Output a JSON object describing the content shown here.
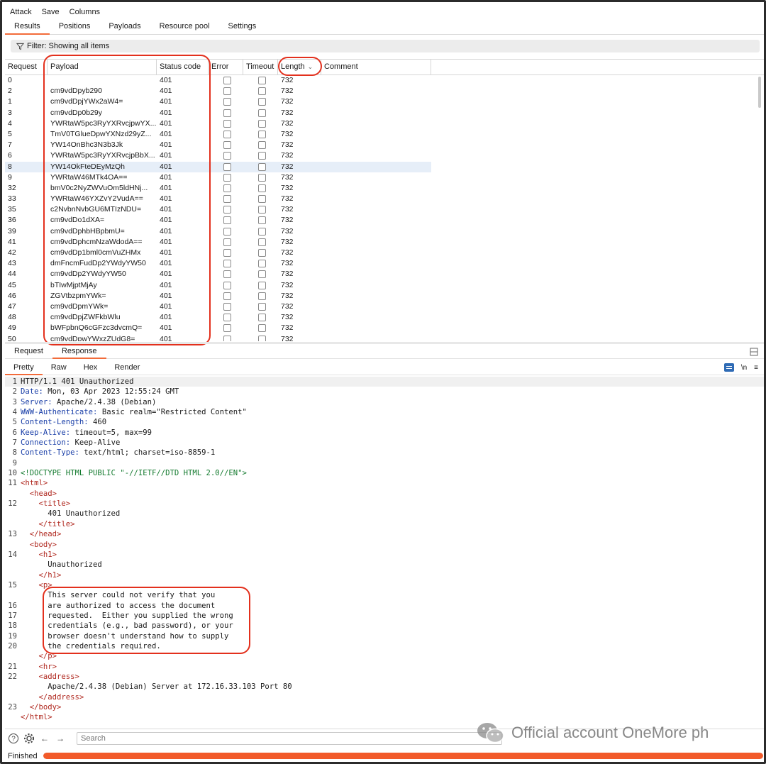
{
  "menu": [
    "Attack",
    "Save",
    "Columns"
  ],
  "attack_tabs": [
    {
      "label": "Results",
      "active": true
    },
    {
      "label": "Positions",
      "active": false
    },
    {
      "label": "Payloads",
      "active": false
    },
    {
      "label": "Resource pool",
      "active": false
    },
    {
      "label": "Settings",
      "active": false
    }
  ],
  "filter": {
    "label": "Filter: Showing all items",
    "icon": "funnel-icon"
  },
  "table": {
    "columns": [
      "Request",
      "Payload",
      "Status code",
      "Error",
      "Timeout",
      "Length",
      "Comment"
    ],
    "sort_column": "Length",
    "selected_request": "8",
    "rows": [
      {
        "request": "0",
        "payload": "",
        "status": "401",
        "length": "732"
      },
      {
        "request": "2",
        "payload": "cm9vdDpyb290",
        "status": "401",
        "length": "732"
      },
      {
        "request": "1",
        "payload": "cm9vdDpjYWx2aW4=",
        "status": "401",
        "length": "732"
      },
      {
        "request": "3",
        "payload": "cm9vdDp0b29y",
        "status": "401",
        "length": "732"
      },
      {
        "request": "4",
        "payload": "YWRtaW5pc3RyYXRvcjpwYX...",
        "status": "401",
        "length": "732"
      },
      {
        "request": "5",
        "payload": "TmV0TGlueDpwYXNzd29yZ...",
        "status": "401",
        "length": "732"
      },
      {
        "request": "7",
        "payload": "YW14OnBhc3N3b3Jk",
        "status": "401",
        "length": "732"
      },
      {
        "request": "6",
        "payload": "YWRtaW5pc3RyYXRvcjpBbX...",
        "status": "401",
        "length": "732"
      },
      {
        "request": "8",
        "payload": "YW14OkFteDEyMzQh",
        "status": "401",
        "length": "732"
      },
      {
        "request": "9",
        "payload": "YWRtaW46MTk4OA==",
        "status": "401",
        "length": "732"
      },
      {
        "request": "32",
        "payload": "bmV0c2NyZWVuOm5ldHNj...",
        "status": "401",
        "length": "732"
      },
      {
        "request": "33",
        "payload": "YWRtaW46YXZvY2VudA==",
        "status": "401",
        "length": "732"
      },
      {
        "request": "35",
        "payload": "c2NvbnNvbGU6MTIzNDU=",
        "status": "401",
        "length": "732"
      },
      {
        "request": "36",
        "payload": "cm9vdDo1dXA=",
        "status": "401",
        "length": "732"
      },
      {
        "request": "39",
        "payload": "cm9vdDphbHBpbmU=",
        "status": "401",
        "length": "732"
      },
      {
        "request": "41",
        "payload": "cm9vdDphcmNzaWdodA==",
        "status": "401",
        "length": "732"
      },
      {
        "request": "42",
        "payload": "cm9vdDp1bml0cmVuZHMx",
        "status": "401",
        "length": "732"
      },
      {
        "request": "43",
        "payload": "dmFncmFudDp2YWdyYW50",
        "status": "401",
        "length": "732"
      },
      {
        "request": "44",
        "payload": "cm9vdDp2YWdyYW50",
        "status": "401",
        "length": "732"
      },
      {
        "request": "45",
        "payload": "bTIwMjptMjAy",
        "status": "401",
        "length": "732"
      },
      {
        "request": "46",
        "payload": "ZGVtbzpmYWk=",
        "status": "401",
        "length": "732"
      },
      {
        "request": "47",
        "payload": "cm9vdDpmYWk=",
        "status": "401",
        "length": "732"
      },
      {
        "request": "48",
        "payload": "cm9vdDpjZWFkbWlu",
        "status": "401",
        "length": "732"
      },
      {
        "request": "49",
        "payload": "bWFpbnQ6cGFzc3dvcmQ=",
        "status": "401",
        "length": "732"
      },
      {
        "request": "50",
        "payload": "cm9vdDpwYWxzZUdG8=",
        "status": "401",
        "length": "732"
      }
    ]
  },
  "message_tabs": [
    {
      "label": "Request",
      "active": false
    },
    {
      "label": "Response",
      "active": true
    }
  ],
  "view_tabs": [
    {
      "label": "Pretty",
      "active": true
    },
    {
      "label": "Raw",
      "active": false
    },
    {
      "label": "Hex",
      "active": false
    },
    {
      "label": "Render",
      "active": false
    }
  ],
  "view_icons": {
    "wrap": "list-icon",
    "newline": "\\n",
    "hidden": "≡"
  },
  "response_lines": [
    {
      "num": "1",
      "text": "HTTP/1.1 401 Unauthorized",
      "kind": "plain"
    },
    {
      "num": "2",
      "key": "Date:",
      "text": " Mon, 03 Apr 2023 12:55:24 GMT",
      "kind": "header"
    },
    {
      "num": "3",
      "key": "Server:",
      "text": " Apache/2.4.38 (Debian)",
      "kind": "header"
    },
    {
      "num": "4",
      "key": "WWW-Authenticate:",
      "text": " Basic realm=\"Restricted Content\"",
      "kind": "header"
    },
    {
      "num": "5",
      "key": "Content-Length:",
      "text": " 460",
      "kind": "header"
    },
    {
      "num": "6",
      "key": "Keep-Alive:",
      "text": " timeout=5, max=99",
      "kind": "header"
    },
    {
      "num": "7",
      "key": "Connection:",
      "text": " Keep-Alive",
      "kind": "header"
    },
    {
      "num": "8",
      "key": "Content-Type:",
      "text": " text/html; charset=iso-8859-1",
      "kind": "header"
    },
    {
      "num": "9",
      "text": "",
      "kind": "plain"
    },
    {
      "num": "10",
      "text": "<!DOCTYPE HTML PUBLIC \"-//IETF//DTD HTML 2.0//EN\">",
      "kind": "doctype"
    },
    {
      "num": "11",
      "text": "<html>",
      "kind": "tag"
    },
    {
      "num": "",
      "text": "  <head>",
      "kind": "tag"
    },
    {
      "num": "12",
      "text": "    <title>",
      "kind": "tag"
    },
    {
      "num": "",
      "text": "      401 Unauthorized",
      "kind": "plain"
    },
    {
      "num": "",
      "text": "    </title>",
      "kind": "tag"
    },
    {
      "num": "13",
      "text": "  </head>",
      "kind": "tag"
    },
    {
      "num": "",
      "text": "  <body>",
      "kind": "tag"
    },
    {
      "num": "14",
      "text": "    <h1>",
      "kind": "tag"
    },
    {
      "num": "",
      "text": "      Unauthorized",
      "kind": "plain"
    },
    {
      "num": "",
      "text": "    </h1>",
      "kind": "tag"
    },
    {
      "num": "15",
      "text": "    <p>",
      "kind": "tag"
    },
    {
      "num": "",
      "text": "      This server could not verify that you",
      "kind": "plain"
    },
    {
      "num": "16",
      "text": "      are authorized to access the document",
      "kind": "plain"
    },
    {
      "num": "17",
      "text": "      requested.  Either you supplied the wrong",
      "kind": "plain"
    },
    {
      "num": "18",
      "text": "      credentials (e.g., bad password), or your",
      "kind": "plain"
    },
    {
      "num": "19",
      "text": "      browser doesn't understand how to supply",
      "kind": "plain"
    },
    {
      "num": "20",
      "text": "      the credentials required.",
      "kind": "plain"
    },
    {
      "num": "",
      "text": "    </p>",
      "kind": "tag"
    },
    {
      "num": "21",
      "text": "    <hr>",
      "kind": "tag"
    },
    {
      "num": "22",
      "text": "    <address>",
      "kind": "tag"
    },
    {
      "num": "",
      "text": "      Apache/2.4.38 (Debian) Server at 172.16.33.103 Port 80",
      "kind": "plain"
    },
    {
      "num": "",
      "text": "    </address>",
      "kind": "tag"
    },
    {
      "num": "23",
      "text": "  </body>",
      "kind": "tag"
    },
    {
      "num": "",
      "text": "</html>",
      "kind": "tag"
    }
  ],
  "bottom": {
    "search_placeholder": "Search"
  },
  "watermark": "Official account OneMore ph",
  "status": {
    "text": "Finished",
    "progress": 1.0
  },
  "colors": {
    "accent": "#f26b3a",
    "annotation": "#e3301d",
    "progress": "#f25a2a"
  }
}
